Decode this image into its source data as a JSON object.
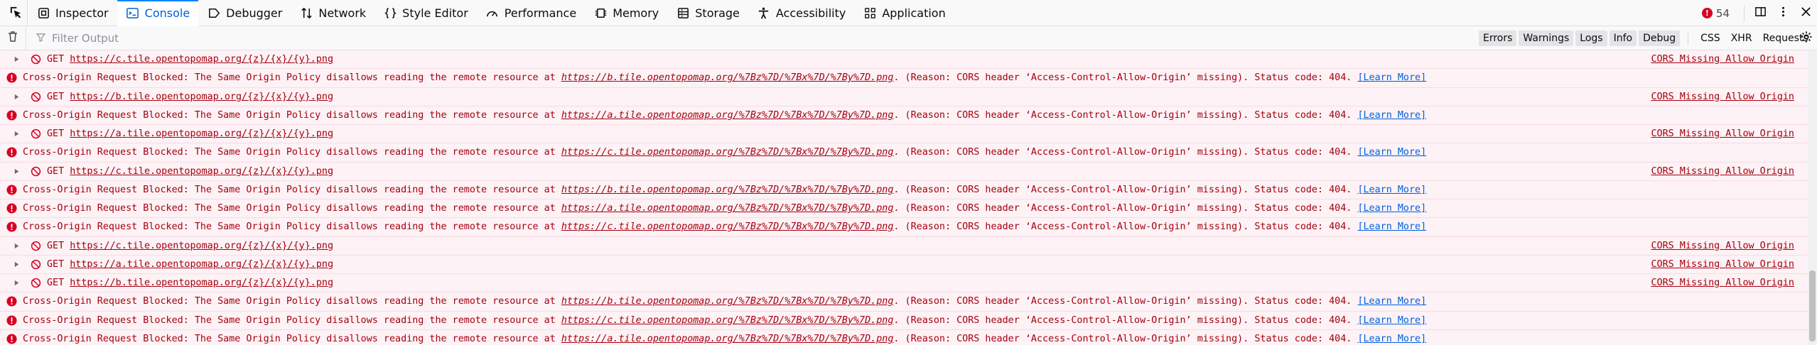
{
  "toolbar": {
    "tabs": [
      {
        "label": "Inspector",
        "icon": "inspector-icon"
      },
      {
        "label": "Console",
        "icon": "console-icon",
        "active": true
      },
      {
        "label": "Debugger",
        "icon": "debugger-icon"
      },
      {
        "label": "Network",
        "icon": "network-icon"
      },
      {
        "label": "Style Editor",
        "icon": "style-editor-icon"
      },
      {
        "label": "Performance",
        "icon": "performance-icon"
      },
      {
        "label": "Memory",
        "icon": "memory-icon"
      },
      {
        "label": "Storage",
        "icon": "storage-icon"
      },
      {
        "label": "Accessibility",
        "icon": "accessibility-icon"
      },
      {
        "label": "Application",
        "icon": "application-icon"
      }
    ],
    "error_count": "54",
    "error_badge": "!"
  },
  "filter": {
    "placeholder": "Filter Output",
    "levels": [
      "Errors",
      "Warnings",
      "Logs",
      "Info",
      "Debug"
    ],
    "categories": [
      "CSS",
      "XHR",
      "Requests"
    ]
  },
  "messages": [
    {
      "kind": "req",
      "method": "GET",
      "url": "https://c.tile.opentopomap.org/{z}/{x}/{y}.png",
      "link": "CORS Missing Allow Origin"
    },
    {
      "kind": "cors",
      "pre": "Cross-Origin Request Blocked: The Same Origin Policy disallows reading the remote resource at ",
      "url": "https://b.tile.opentopomap.org/%7Bz%7D/%7Bx%7D/%7By%7D.png",
      "post": ". (Reason: CORS header ‘Access-Control-Allow-Origin’ missing). Status code: 404. ",
      "learn": "[Learn More]"
    },
    {
      "kind": "req",
      "method": "GET",
      "url": "https://b.tile.opentopomap.org/{z}/{x}/{y}.png",
      "link": "CORS Missing Allow Origin"
    },
    {
      "kind": "cors",
      "pre": "Cross-Origin Request Blocked: The Same Origin Policy disallows reading the remote resource at ",
      "url": "https://a.tile.opentopomap.org/%7Bz%7D/%7Bx%7D/%7By%7D.png",
      "post": ". (Reason: CORS header ‘Access-Control-Allow-Origin’ missing). Status code: 404. ",
      "learn": "[Learn More]"
    },
    {
      "kind": "req",
      "method": "GET",
      "url": "https://a.tile.opentopomap.org/{z}/{x}/{y}.png",
      "link": "CORS Missing Allow Origin"
    },
    {
      "kind": "cors",
      "pre": "Cross-Origin Request Blocked: The Same Origin Policy disallows reading the remote resource at ",
      "url": "https://c.tile.opentopomap.org/%7Bz%7D/%7Bx%7D/%7By%7D.png",
      "post": ". (Reason: CORS header ‘Access-Control-Allow-Origin’ missing). Status code: 404. ",
      "learn": "[Learn More]"
    },
    {
      "kind": "req",
      "method": "GET",
      "url": "https://c.tile.opentopomap.org/{z}/{x}/{y}.png",
      "link": "CORS Missing Allow Origin"
    },
    {
      "kind": "cors",
      "pre": "Cross-Origin Request Blocked: The Same Origin Policy disallows reading the remote resource at ",
      "url": "https://b.tile.opentopomap.org/%7Bz%7D/%7Bx%7D/%7By%7D.png",
      "post": ". (Reason: CORS header ‘Access-Control-Allow-Origin’ missing). Status code: 404. ",
      "learn": "[Learn More]"
    },
    {
      "kind": "cors",
      "pre": "Cross-Origin Request Blocked: The Same Origin Policy disallows reading the remote resource at ",
      "url": "https://a.tile.opentopomap.org/%7Bz%7D/%7Bx%7D/%7By%7D.png",
      "post": ". (Reason: CORS header ‘Access-Control-Allow-Origin’ missing). Status code: 404. ",
      "learn": "[Learn More]"
    },
    {
      "kind": "cors",
      "pre": "Cross-Origin Request Blocked: The Same Origin Policy disallows reading the remote resource at ",
      "url": "https://c.tile.opentopomap.org/%7Bz%7D/%7Bx%7D/%7By%7D.png",
      "post": ". (Reason: CORS header ‘Access-Control-Allow-Origin’ missing). Status code: 404. ",
      "learn": "[Learn More]"
    },
    {
      "kind": "req",
      "method": "GET",
      "url": "https://c.tile.opentopomap.org/{z}/{x}/{y}.png",
      "link": "CORS Missing Allow Origin"
    },
    {
      "kind": "req",
      "method": "GET",
      "url": "https://a.tile.opentopomap.org/{z}/{x}/{y}.png",
      "link": "CORS Missing Allow Origin"
    },
    {
      "kind": "req",
      "method": "GET",
      "url": "https://b.tile.opentopomap.org/{z}/{x}/{y}.png",
      "link": "CORS Missing Allow Origin"
    },
    {
      "kind": "cors",
      "pre": "Cross-Origin Request Blocked: The Same Origin Policy disallows reading the remote resource at ",
      "url": "https://b.tile.opentopomap.org/%7Bz%7D/%7Bx%7D/%7By%7D.png",
      "post": ". (Reason: CORS header ‘Access-Control-Allow-Origin’ missing). Status code: 404. ",
      "learn": "[Learn More]"
    },
    {
      "kind": "cors",
      "pre": "Cross-Origin Request Blocked: The Same Origin Policy disallows reading the remote resource at ",
      "url": "https://c.tile.opentopomap.org/%7Bz%7D/%7Bx%7D/%7By%7D.png",
      "post": ". (Reason: CORS header ‘Access-Control-Allow-Origin’ missing). Status code: 404. ",
      "learn": "[Learn More]"
    },
    {
      "kind": "cors",
      "pre": "Cross-Origin Request Blocked: The Same Origin Policy disallows reading the remote resource at ",
      "url": "https://a.tile.opentopomap.org/%7Bz%7D/%7Bx%7D/%7By%7D.png",
      "post": ". (Reason: CORS header ‘Access-Control-Allow-Origin’ missing). Status code: 404. ",
      "learn": "[Learn More]"
    }
  ],
  "colors": {
    "error_text": "#a4000f",
    "error_bg": "#fdf2f5",
    "active_tab": "#0060df",
    "learn_more": "#0060df"
  }
}
